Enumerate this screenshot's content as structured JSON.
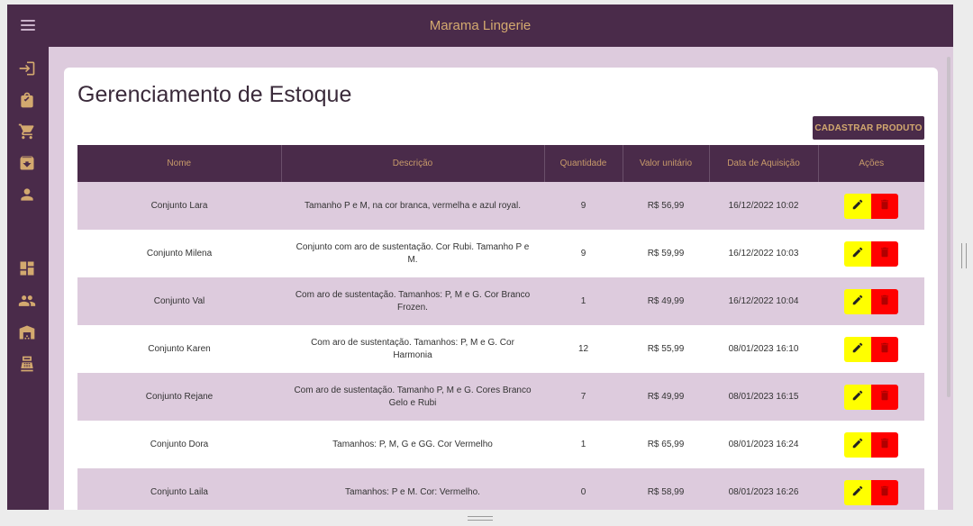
{
  "app": {
    "title": "Marama Lingerie"
  },
  "colors": {
    "primary": "#4a2b4a",
    "accent": "#d3a96f",
    "row_alt": "#ddcbdd",
    "edit": "#ffff00",
    "delete": "#ff0000"
  },
  "sidebar": {
    "items": [
      {
        "icon": "login-icon"
      },
      {
        "icon": "shopping-bag-icon"
      },
      {
        "icon": "cart-icon"
      },
      {
        "icon": "archive-icon"
      },
      {
        "icon": "person-icon"
      },
      {
        "icon": "dashboard-icon"
      },
      {
        "icon": "people-icon"
      },
      {
        "icon": "warehouse-icon"
      },
      {
        "icon": "cash-register-icon"
      }
    ]
  },
  "page": {
    "title": "Gerenciamento de Estoque",
    "add_button": "CADASTRAR PRODUTO"
  },
  "table": {
    "headers": {
      "nome": "Nome",
      "descricao": "Descrição",
      "quantidade": "Quantidade",
      "valor": "Valor unitário",
      "data": "Data de Aquisição",
      "acoes": "Ações"
    },
    "rows": [
      {
        "nome": "Conjunto Lara",
        "descricao": "Tamanho P e M, na cor branca, vermelha e azul royal.",
        "quantidade": "9",
        "valor": "R$ 56,99",
        "data": "16/12/2022 10:02"
      },
      {
        "nome": "Conjunto Milena",
        "descricao": "Conjunto com aro de sustentação. Cor Rubi. Tamanho P e M.",
        "quantidade": "9",
        "valor": "R$ 59,99",
        "data": "16/12/2022 10:03"
      },
      {
        "nome": "Conjunto Val",
        "descricao": "Com aro de sustentação. Tamanhos: P, M e G. Cor Branco Frozen.",
        "quantidade": "1",
        "valor": "R$ 49,99",
        "data": "16/12/2022 10:04"
      },
      {
        "nome": "Conjunto Karen",
        "descricao": "Com aro de sustentação. Tamanhos: P, M e G. Cor Harmonia",
        "quantidade": "12",
        "valor": "R$ 55,99",
        "data": "08/01/2023 16:10"
      },
      {
        "nome": "Conjunto Rejane",
        "descricao": "Com aro de sustentação. Tamanho P, M e G. Cores Branco Gelo e Rubi",
        "quantidade": "7",
        "valor": "R$ 49,99",
        "data": "08/01/2023 16:15"
      },
      {
        "nome": "Conjunto Dora",
        "descricao": "Tamanhos: P, M, G e GG. Cor Vermelho",
        "quantidade": "1",
        "valor": "R$ 65,99",
        "data": "08/01/2023 16:24"
      },
      {
        "nome": "Conjunto Laila",
        "descricao": "Tamanhos: P e M. Cor: Vermelho.",
        "quantidade": "0",
        "valor": "R$ 58,99",
        "data": "08/01/2023 16:26"
      }
    ]
  }
}
